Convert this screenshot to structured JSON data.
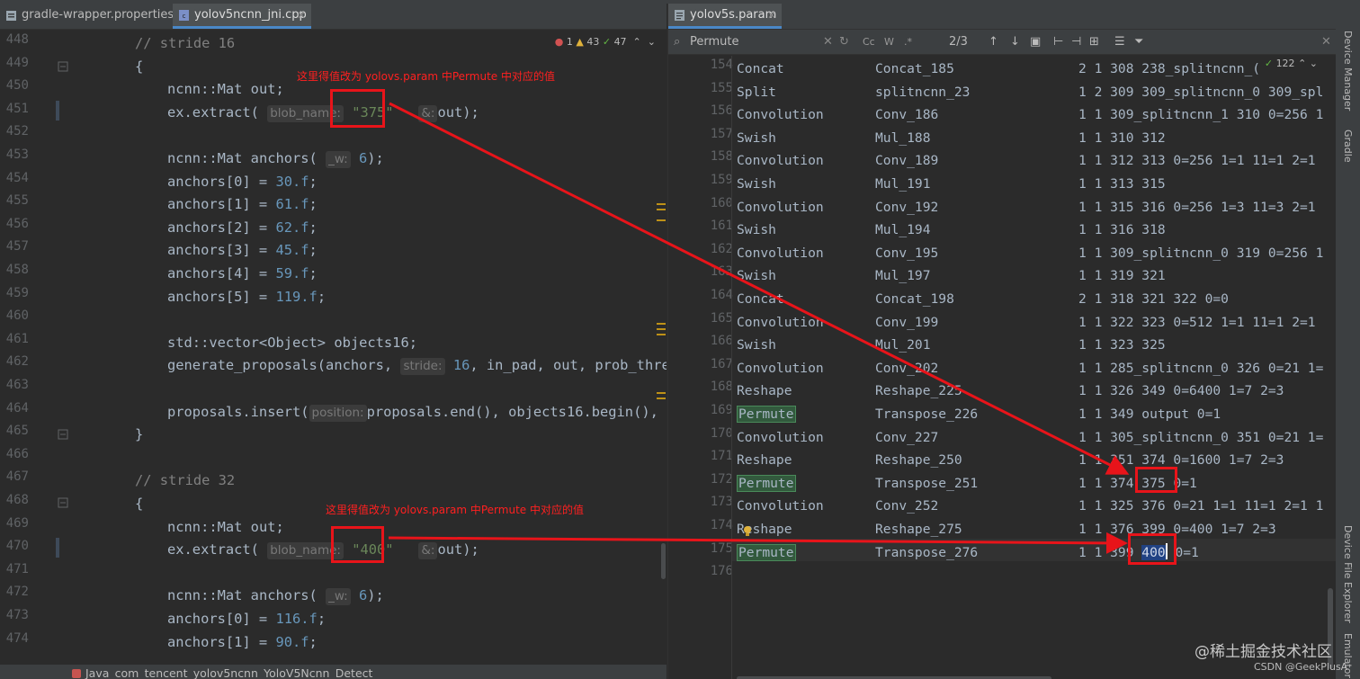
{
  "left_editor": {
    "tabs": [
      {
        "label": "gradle-wrapper.properties",
        "active": false
      },
      {
        "label": "yolov5ncnn_jni.cpp",
        "active": true
      }
    ],
    "inspection": {
      "errors": "1",
      "warnings": "43",
      "ok": "47"
    },
    "line_numbers": [
      "448",
      "449",
      "450",
      "451",
      "452",
      "453",
      "454",
      "455",
      "456",
      "457",
      "458",
      "459",
      "460",
      "461",
      "462",
      "463",
      "464",
      "465",
      "466",
      "467",
      "468",
      "469",
      "470",
      "471",
      "472",
      "473",
      "474"
    ],
    "code": {
      "l448": "// stride 16",
      "l449": "{",
      "l450_a": "ncnn::Mat",
      "l450_b": " out;",
      "l451_a": "ex.extract(",
      "l451_hint": "blob_name:",
      "l451_str": "\"375\"",
      "l451_hint2": "&:",
      "l451_b": "out);",
      "l453_a": "ncnn::Mat",
      "l453_b": " anchors(",
      "l453_hint": "_w:",
      "l453_num": "6",
      "l453_c": ");",
      "anchors16": [
        {
          "lhs": "anchors[0] = ",
          "val": "30.f",
          "end": ";"
        },
        {
          "lhs": "anchors[1] = ",
          "val": "61.f",
          "end": ";"
        },
        {
          "lhs": "anchors[2] = ",
          "val": "62.f",
          "end": ";"
        },
        {
          "lhs": "anchors[3] = ",
          "val": "45.f",
          "end": ";"
        },
        {
          "lhs": "anchors[4] = ",
          "val": "59.f",
          "end": ";"
        },
        {
          "lhs": "anchors[5] = ",
          "val": "119.f",
          "end": ";"
        }
      ],
      "l461": "std::vector<Object> objects16;",
      "l462_a": "generate_proposals(anchors,",
      "l462_hint": "stride:",
      "l462_num": "16",
      "l462_b": ", in_pad, out, prob_thres",
      "l464_a": "proposals.insert(",
      "l464_hint": "position:",
      "l464_b": "proposals.end(), objects16.begin(), o",
      "l465": "}",
      "l467": "// stride 32",
      "l468": "{",
      "l469_a": "ncnn::Mat",
      "l469_b": " out;",
      "l470_a": "ex.extract(",
      "l470_hint": "blob_name:",
      "l470_str": "\"400\"",
      "l470_hint2": "&:",
      "l470_b": "out);",
      "l472_a": "ncnn::Mat",
      "l472_b": " anchors(",
      "l472_hint": "_w:",
      "l472_num": "6",
      "l472_c": ");",
      "l473_lhs": "anchors[0] = ",
      "l473_val": "116.f",
      "l473_end": ";",
      "l474_lhs": "anchors[1] = ",
      "l474_val": "90.f",
      "l474_end": ";"
    },
    "breadcrumb": "Java_com_tencent_yolov5ncnn_YoloV5Ncnn_Detect"
  },
  "right_editor": {
    "tab": "yolov5s.param",
    "find": {
      "query": "Permute",
      "match_case": "Cc",
      "words": "W",
      "regex": ".*",
      "count": "2/3"
    },
    "match_count": "122",
    "line_numbers": [
      "154",
      "155",
      "156",
      "157",
      "158",
      "159",
      "160",
      "161",
      "162",
      "163",
      "164",
      "165",
      "166",
      "167",
      "168",
      "169",
      "170",
      "171",
      "172",
      "173",
      "174",
      "175",
      "176"
    ],
    "rows": [
      {
        "type": "Concat",
        "name": "Concat_185",
        "rest": "2 1 308 238_splitncnn_("
      },
      {
        "type": "Split",
        "name": "splitncnn_23",
        "rest": "1 2 309 309_splitncnn_0 309_spl"
      },
      {
        "type": "Convolution",
        "name": "Conv_186",
        "rest": "1 1 309_splitncnn_1 310 0=256 1"
      },
      {
        "type": "Swish",
        "name": "Mul_188",
        "rest": "1 1 310 312"
      },
      {
        "type": "Convolution",
        "name": "Conv_189",
        "rest": "1 1 312 313 0=256 1=1 11=1 2=1"
      },
      {
        "type": "Swish",
        "name": "Mul_191",
        "rest": "1 1 313 315"
      },
      {
        "type": "Convolution",
        "name": "Conv_192",
        "rest": "1 1 315 316 0=256 1=3 11=3 2=1"
      },
      {
        "type": "Swish",
        "name": "Mul_194",
        "rest": "1 1 316 318"
      },
      {
        "type": "Convolution",
        "name": "Conv_195",
        "rest": "1 1 309_splitncnn_0 319 0=256 1"
      },
      {
        "type": "Swish",
        "name": "Mul_197",
        "rest": "1 1 319 321"
      },
      {
        "type": "Concat",
        "name": "Concat_198",
        "rest": "2 1 318 321 322 0=0"
      },
      {
        "type": "Convolution",
        "name": "Conv_199",
        "rest": "1 1 322 323 0=512 1=1 11=1 2=1"
      },
      {
        "type": "Swish",
        "name": "Mul_201",
        "rest": "1 1 323 325"
      },
      {
        "type": "Convolution",
        "name": "Conv_202",
        "rest": "1 1 285_splitncnn_0 326 0=21 1="
      },
      {
        "type": "Reshape",
        "name": "Reshape_225",
        "rest": "1 1 326 349 0=6400 1=7 2=3"
      },
      {
        "type": "Permute",
        "name": "Transpose_226",
        "rest": "1 1 349 output 0=1"
      },
      {
        "type": "Convolution",
        "name": "Conv_227",
        "rest": "1 1 305_splitncnn_0 351 0=21 1="
      },
      {
        "type": "Reshape",
        "name": "Reshape_250",
        "rest": "1 1 351 374 0=1600 1=7 2=3"
      },
      {
        "type": "Permute",
        "name": "Transpose_251",
        "rest_a": "1 1 374 ",
        "rest_hl": "375",
        "rest_b": " 0=1"
      },
      {
        "type": "Convolution",
        "name": "Conv_252",
        "rest": "1 1 325 376 0=21 1=1 11=1 2=1 1"
      },
      {
        "type": "Reshape",
        "name": "Reshape_275",
        "rest": "1 1 376 399 0=400 1=7 2=3"
      },
      {
        "type": "Permute",
        "name": "Transpose_276",
        "rest_a": "1 1 399 ",
        "rest_hl": "400",
        "rest_b": " 0=1"
      }
    ]
  },
  "tool_window": {
    "device_manager": "Device Manager",
    "gradle": "Gradle",
    "device_file_explorer": "Device File Explorer",
    "emulator": "Emulator"
  },
  "annotations": {
    "note_top": "这里得值改为 yolovs.param 中Permute 中对应的值",
    "note_bottom": "这里得值改为 yolovs.param 中Permute 中对应的值",
    "color": "#e8141a"
  },
  "watermark": {
    "site": "@稀土掘金技术社区",
    "author": "CSDN @GeekPlusA"
  },
  "colors": {
    "keyword": "#cc7832",
    "number": "#6897bb",
    "string": "#6a8759",
    "comment": "#808080",
    "text": "#a9b7c6",
    "match_bg": "#32593d"
  }
}
